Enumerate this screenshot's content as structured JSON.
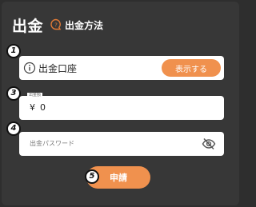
{
  "header": {
    "title": "出金",
    "help_label": "出金方法"
  },
  "account_field": {
    "label": "出金口座",
    "show_button": "表示する"
  },
  "amount_field": {
    "label": "出金額",
    "currency": "¥",
    "value": "0"
  },
  "password_field": {
    "placeholder": "出金パスワード"
  },
  "submit_button": "申請",
  "annotations": {
    "b1": "1",
    "b3": "3",
    "b4": "4",
    "b5": "5"
  },
  "colors": {
    "accent": "#f0914e",
    "panel": "#373737",
    "background": "#2e2e2e"
  }
}
